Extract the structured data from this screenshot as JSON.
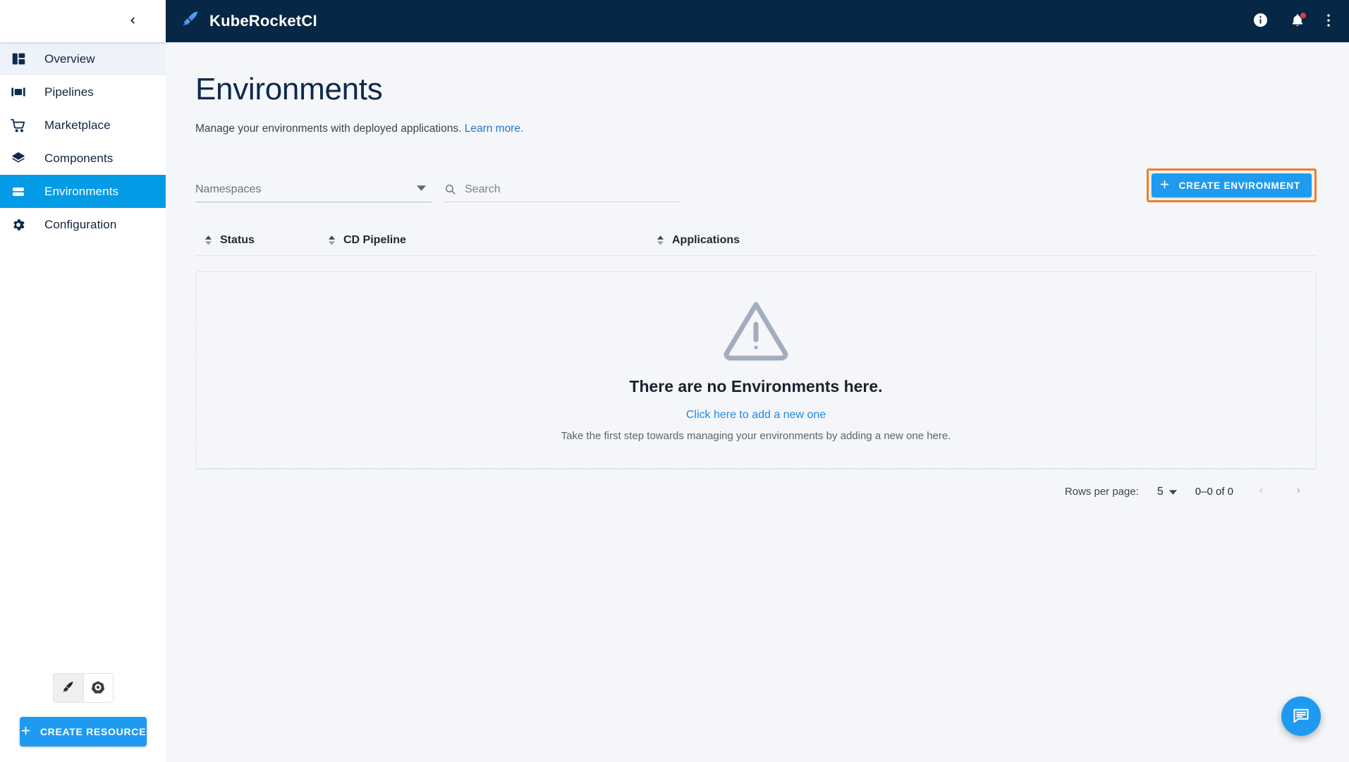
{
  "sidebar": {
    "collapse_icon": "chevron-left-icon",
    "items": [
      {
        "label": "Overview",
        "icon": "dashboard-icon",
        "state": "hovered"
      },
      {
        "label": "Pipelines",
        "icon": "pipelines-icon",
        "state": "default"
      },
      {
        "label": "Marketplace",
        "icon": "cart-icon",
        "state": "default"
      },
      {
        "label": "Components",
        "icon": "layers-icon",
        "state": "default"
      },
      {
        "label": "Environments",
        "icon": "environments-icon",
        "state": "active"
      },
      {
        "label": "Configuration",
        "icon": "gear-icon",
        "state": "default"
      }
    ],
    "toggles": [
      {
        "icon": "krci-rocket-icon",
        "selected": true
      },
      {
        "icon": "kubernetes-icon",
        "selected": false
      }
    ],
    "create_resource_label": "CREATE RESOURCE",
    "create_resource_icon": "plus-icon"
  },
  "topbar": {
    "logo_icon": "krci-rocket-logo",
    "brand": "KubeRocketCI",
    "info_icon": "info-icon",
    "notifications_icon": "bell-icon",
    "notifications_badge": true,
    "more_icon": "more-vertical-icon"
  },
  "page": {
    "title": "Environments",
    "subtitle": "Manage your environments with deployed applications.",
    "learn_more": "Learn more."
  },
  "filters": {
    "namespaces_placeholder": "Namespaces",
    "namespaces_value": "",
    "namespaces_icon": "chevron-down-icon",
    "search_placeholder": "Search",
    "search_value": "",
    "search_icon": "search-icon"
  },
  "actions": {
    "create_environment_label": "CREATE ENVIRONMENT",
    "create_environment_icon": "plus-icon",
    "focus_outline_color": "#f57c1f"
  },
  "table": {
    "columns": [
      {
        "label": "Status",
        "sortable": true
      },
      {
        "label": "CD Pipeline",
        "sortable": true
      },
      {
        "label": "Applications",
        "sortable": true
      }
    ],
    "rows": [],
    "empty_state": {
      "icon": "warning-triangle-icon",
      "title": "There are no Environments here.",
      "link": "Click here to add a new one",
      "description": "Take the first step towards managing your environments by adding a new one here."
    }
  },
  "pagination": {
    "rows_per_page_label": "Rows per page:",
    "rows_per_page_value": "5",
    "rows_per_page_icon": "chevron-down-icon",
    "range": "0–0 of 0",
    "prev_icon": "chevron-left-icon",
    "next_icon": "chevron-right-icon"
  },
  "fab": {
    "icon": "chat-bubble-icon"
  },
  "colors": {
    "brand_dark": "#062746",
    "accent_blue": "#039be5",
    "button_blue": "#1e9bf0",
    "link_blue": "#1976d2",
    "page_bg": "#f5f6fa",
    "focus_orange": "#f57c1f"
  }
}
